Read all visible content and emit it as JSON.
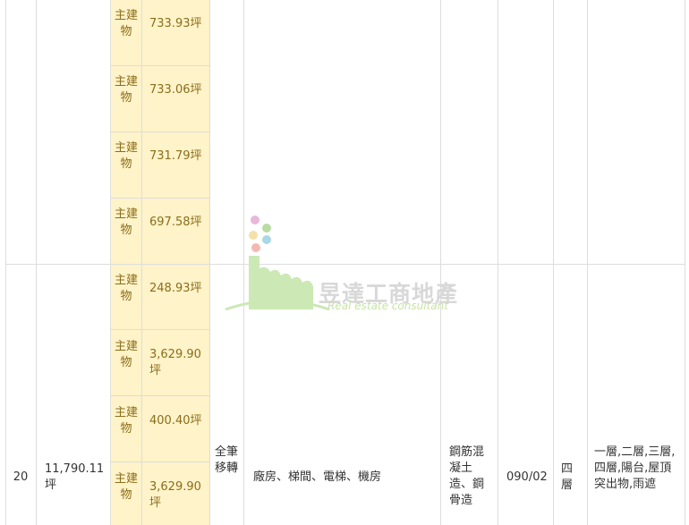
{
  "sections": [
    {
      "entries": [
        {
          "label": "主建物",
          "area": "733.93坪"
        },
        {
          "label": "主建物",
          "area": "733.06坪"
        },
        {
          "label": "主建物",
          "area": "731.79坪"
        },
        {
          "label": "主建物",
          "area": "697.58坪"
        }
      ]
    },
    {
      "entries": [
        {
          "label": "主建物",
          "area": "248.93坪"
        },
        {
          "label": "主建物",
          "area": "3,629.90坪"
        },
        {
          "label": "主建物",
          "area": "400.40坪"
        },
        {
          "label": "主建物",
          "area": "3,629.90坪"
        }
      ],
      "row": {
        "number": "20",
        "total_area": "11,790.11坪",
        "transfer": "全筆移轉",
        "uses": "廠房、梯間、電梯、機房",
        "structure": "鋼筋混凝土造、鋼骨造",
        "date": "090/02",
        "floors": "四層",
        "floor_detail": "一層,二層,三層,四層,陽台,屋頂突出物,雨遮"
      }
    }
  ],
  "watermark": {
    "title": "昱達工商地產",
    "subtitle": "Real estate consultant"
  }
}
